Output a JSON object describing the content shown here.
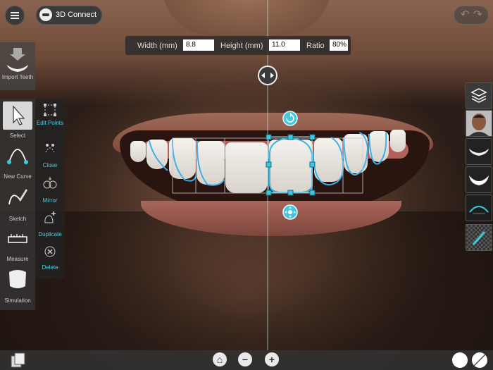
{
  "toolbar": {
    "connect_label": "3D Connect"
  },
  "measure": {
    "width_label": "Width (mm)",
    "width_value": "8.8",
    "height_label": "Height (mm)",
    "height_value": "11.0",
    "ratio_label": "Ratio",
    "ratio_value": "80%"
  },
  "left_panel": {
    "import_label": "Import Teeth",
    "tools": [
      {
        "label": "Select",
        "icon": "cursor-icon"
      },
      {
        "label": "New Curve",
        "icon": "curve-icon"
      },
      {
        "label": "Sketch",
        "icon": "pencil-icon"
      },
      {
        "label": "Measure",
        "icon": "ruler-icon"
      },
      {
        "label": "Simulation",
        "icon": "tooth-icon"
      }
    ],
    "sub_tools": [
      {
        "label": "Edit Points",
        "icon": "edit-points-icon"
      },
      {
        "label": "Close",
        "icon": "close-shape-icon"
      },
      {
        "label": "Mirror",
        "icon": "mirror-icon"
      },
      {
        "label": "Duplicate",
        "icon": "duplicate-icon"
      },
      {
        "label": "Delete",
        "icon": "delete-icon"
      }
    ]
  },
  "right_panel": {
    "items": [
      "layers-icon",
      "face-photo",
      "smile-photo",
      "teeth-photo",
      "arch-scan",
      "texture-layer"
    ]
  },
  "colors": {
    "accent": "#3fc0dd",
    "handle": "#3fc8e0",
    "panel": "#3a3a3a"
  }
}
